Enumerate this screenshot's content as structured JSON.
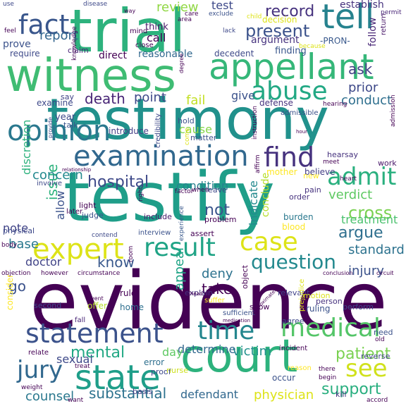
{
  "words": [
    {
      "text": "evidence",
      "color": "#440154"
    },
    {
      "text": "testify",
      "color": "#1f9e89"
    },
    {
      "text": "testimony",
      "color": "#21918c"
    },
    {
      "text": "trial",
      "color": "#2db27d"
    },
    {
      "text": "witness",
      "color": "#3fbc73"
    },
    {
      "text": "court",
      "color": "#2db27d"
    },
    {
      "text": "appellant",
      "color": "#35b779"
    },
    {
      "text": "examination",
      "color": "#31688e"
    },
    {
      "text": "statement",
      "color": "#3b528b"
    },
    {
      "text": "expert",
      "color": "#dde318"
    },
    {
      "text": "state",
      "color": "#1f9e89"
    },
    {
      "text": "result",
      "color": "#20a486"
    },
    {
      "text": "opinion",
      "color": "#2a788e"
    },
    {
      "text": "fact",
      "color": "#39568c"
    },
    {
      "text": "tell",
      "color": "#26828e"
    },
    {
      "text": "abuse",
      "color": "#22a884"
    },
    {
      "text": "time",
      "color": "#24868e"
    },
    {
      "text": "medical",
      "color": "#54c568"
    },
    {
      "text": "case",
      "color": "#dde318"
    },
    {
      "text": "find",
      "color": "#46327e"
    },
    {
      "text": "admit",
      "color": "#2ab07f"
    },
    {
      "text": "jury",
      "color": "#31688e"
    },
    {
      "text": "question",
      "color": "#23898e"
    },
    {
      "text": "see",
      "color": "#d0e11c"
    },
    {
      "text": "hospital",
      "color": "#3e4989"
    },
    {
      "text": "present",
      "color": "#3b528b"
    },
    {
      "text": "record",
      "color": "#46327e"
    },
    {
      "text": "argue",
      "color": "#2e6f8e"
    },
    {
      "text": "cross",
      "color": "#7ad151"
    },
    {
      "text": "not",
      "color": "#39558c"
    },
    {
      "text": "mental",
      "color": "#22a884"
    },
    {
      "text": "support",
      "color": "#29af7f"
    },
    {
      "text": "patient",
      "color": "#7ad151"
    },
    {
      "text": "death",
      "color": "#482576"
    },
    {
      "text": "report",
      "color": "#32658e"
    },
    {
      "text": "ask",
      "color": "#433e85"
    },
    {
      "text": "know",
      "color": "#38588c"
    },
    {
      "text": "take",
      "color": "#440154"
    },
    {
      "text": "issue",
      "color": "#2db27d"
    },
    {
      "text": "physician",
      "color": "#dde318"
    },
    {
      "text": "substantial",
      "color": "#2c728e"
    },
    {
      "text": "defendant",
      "color": "#31688e"
    },
    {
      "text": "counsel",
      "color": "#2a788e"
    },
    {
      "text": "sexual",
      "color": "#3e4989"
    },
    {
      "text": "victim",
      "color": "#21918c"
    },
    {
      "text": "determine",
      "color": "#31688e"
    },
    {
      "text": "injury",
      "color": "#3b528b"
    },
    {
      "text": "treatment",
      "color": "#4ac16d"
    },
    {
      "text": "verdict",
      "color": "#5ec962"
    },
    {
      "text": "condition",
      "color": "#26828e"
    },
    {
      "text": "concern",
      "color": "#23898e"
    },
    {
      "text": "standard",
      "color": "#2c728e"
    },
    {
      "text": "review",
      "color": "#90d743"
    },
    {
      "text": "prior",
      "color": "#3e4989"
    },
    {
      "text": "conduct",
      "color": "#2e6f8e"
    },
    {
      "text": "give",
      "color": "#3b528b"
    },
    {
      "text": "fail",
      "color": "#c2df23"
    },
    {
      "text": "point",
      "color": "#3e4989"
    },
    {
      "text": "cause",
      "color": "#86d549"
    },
    {
      "text": "discretion",
      "color": "#2db27d"
    },
    {
      "text": "base",
      "color": "#2a788e"
    },
    {
      "text": "go",
      "color": "#3b528b"
    },
    {
      "text": "doctor",
      "color": "#414487"
    },
    {
      "text": "deny",
      "color": "#2c728e"
    },
    {
      "text": "appeal",
      "color": "#20a486"
    },
    {
      "text": "day",
      "color": "#5ec962"
    },
    {
      "text": "note",
      "color": "#414487"
    },
    {
      "text": "allow",
      "color": "#3b528b"
    },
    {
      "text": "indicate",
      "color": "#23898e"
    },
    {
      "text": "conclude",
      "color": "#b5de2b"
    },
    {
      "text": "argument",
      "color": "#46327e"
    },
    {
      "text": "test",
      "color": "#3e4989"
    },
    {
      "text": "prove",
      "color": "#3b528b"
    },
    {
      "text": "require",
      "color": "#3e4989"
    },
    {
      "text": "reasonable",
      "color": "#31688e"
    },
    {
      "text": "direct",
      "color": "#440154"
    },
    {
      "text": "finding",
      "color": "#39568c"
    },
    {
      "text": "follow",
      "color": "#482677"
    },
    {
      "text": "establish",
      "color": "#46327e"
    },
    {
      "text": "call",
      "color": "#440154"
    },
    {
      "text": "think",
      "color": "#481769"
    },
    {
      "text": "-PRON-",
      "color": "#38588c"
    },
    {
      "text": "year",
      "color": "#3e4989"
    },
    {
      "text": "believe",
      "color": "#433e85"
    },
    {
      "text": "defense",
      "color": "#46327e"
    },
    {
      "text": "hold",
      "color": "#3b528b"
    },
    {
      "text": "introduce",
      "color": "#433e85"
    },
    {
      "text": "talk",
      "color": "#39558c"
    },
    {
      "text": "matter",
      "color": "#3b528b"
    },
    {
      "text": "examine",
      "color": "#3e4989"
    },
    {
      "text": "light",
      "color": "#440154"
    },
    {
      "text": "judge",
      "color": "#3b528b"
    },
    {
      "text": "include",
      "color": "#481769"
    },
    {
      "text": "problem",
      "color": "#440154"
    },
    {
      "text": "physical",
      "color": "#3e4989"
    },
    {
      "text": "rule",
      "color": "#440154"
    },
    {
      "text": "offer",
      "color": "#b5de2b"
    },
    {
      "text": "home",
      "color": "#2e6f8e"
    },
    {
      "text": "explain",
      "color": "#46327e"
    },
    {
      "text": "error",
      "color": "#2e6f8e"
    },
    {
      "text": "proof",
      "color": "#3e4989"
    },
    {
      "text": "ruling",
      "color": "#3b528b"
    },
    {
      "text": "person",
      "color": "#46327e"
    },
    {
      "text": "perform",
      "color": "#3e4989"
    },
    {
      "text": "relevant",
      "color": "#414487"
    },
    {
      "text": "motion",
      "color": "#dde318"
    },
    {
      "text": "basis",
      "color": "#433e85"
    },
    {
      "text": "consider",
      "color": "#fde725"
    },
    {
      "text": "blood",
      "color": "#fde725"
    },
    {
      "text": "burden",
      "color": "#2a788e"
    },
    {
      "text": "hearsay",
      "color": "#46327e"
    },
    {
      "text": "work",
      "color": "#481769"
    },
    {
      "text": "pain",
      "color": "#46327e"
    },
    {
      "text": "order",
      "color": "#46327e"
    },
    {
      "text": "claim",
      "color": "#482576"
    },
    {
      "text": "mind",
      "color": "#440154"
    },
    {
      "text": "say",
      "color": "#414487"
    },
    {
      "text": "fall",
      "color": "#482576"
    },
    {
      "text": "second",
      "color": "#3e4989"
    },
    {
      "text": "mother",
      "color": "#fde725"
    },
    {
      "text": "experience",
      "color": "#38588c"
    },
    {
      "text": "assert",
      "color": "#440154"
    },
    {
      "text": "interview",
      "color": "#3b528b"
    },
    {
      "text": "leave",
      "color": "#3e4989"
    },
    {
      "text": "agree",
      "color": "#3e4989"
    },
    {
      "text": "show",
      "color": "#440154"
    },
    {
      "text": "new",
      "color": "#fde725"
    },
    {
      "text": "object",
      "color": "#440154"
    },
    {
      "text": "sufficient",
      "color": "#3b528b"
    },
    {
      "text": "incident",
      "color": "#440154"
    },
    {
      "text": "reverse",
      "color": "#414487"
    },
    {
      "text": "occur",
      "color": "#3b528b"
    },
    {
      "text": "decision",
      "color": "#dde318"
    },
    {
      "text": "nurse",
      "color": "#cde11d"
    },
    {
      "text": "kill",
      "color": "#46327e"
    },
    {
      "text": "relate",
      "color": "#440154"
    },
    {
      "text": "need",
      "color": "#3b528b"
    },
    {
      "text": "use",
      "color": "#3e4989"
    },
    {
      "text": "feel",
      "color": "#440154"
    },
    {
      "text": "disease",
      "color": "#3e4989"
    },
    {
      "text": "care",
      "color": "#440154"
    },
    {
      "text": "exclude",
      "color": "#3b528b"
    },
    {
      "text": "area",
      "color": "#440154"
    },
    {
      "text": "child",
      "color": "#dde318"
    },
    {
      "text": "permit",
      "color": "#482576"
    },
    {
      "text": "lack",
      "color": "#3e4989"
    },
    {
      "text": "return",
      "color": "#481769"
    },
    {
      "text": "close",
      "color": "#440154"
    },
    {
      "text": "because",
      "color": "#dde318"
    },
    {
      "text": "knowledge",
      "color": "#440154"
    },
    {
      "text": "decedent",
      "color": "#3e4989"
    },
    {
      "text": "admissible",
      "color": "#3b528b"
    },
    {
      "text": "hearing",
      "color": "#440154"
    },
    {
      "text": "degree",
      "color": "#440154"
    },
    {
      "text": "credibility",
      "color": "#3e4989"
    },
    {
      "text": "instruction",
      "color": "#440154"
    },
    {
      "text": "involve",
      "color": "#3e4989"
    },
    {
      "text": "provide",
      "color": "#3e4989"
    },
    {
      "text": "come",
      "color": "#dde318"
    },
    {
      "text": "affirm",
      "color": "#440154"
    },
    {
      "text": "meet",
      "color": "#440154"
    },
    {
      "text": "heart",
      "color": "#440154"
    },
    {
      "text": "factor",
      "color": "#440154"
    },
    {
      "text": "when",
      "color": "#440154"
    },
    {
      "text": "suffer",
      "color": "#fde725"
    },
    {
      "text": "right",
      "color": "#440154"
    },
    {
      "text": "later",
      "color": "#440154"
    },
    {
      "text": "contend",
      "color": "#3e4989"
    },
    {
      "text": "room",
      "color": "#440154"
    },
    {
      "text": "objection",
      "color": "#440154"
    },
    {
      "text": "however",
      "color": "#440154"
    },
    {
      "text": "circumstance",
      "color": "#440154"
    },
    {
      "text": "conclusion",
      "color": "#440154"
    },
    {
      "text": "circuit",
      "color": "#440154"
    },
    {
      "text": "prejudice",
      "color": "#dde318"
    },
    {
      "text": "reason",
      "color": "#fde725"
    },
    {
      "text": "there",
      "color": "#440154"
    },
    {
      "text": "begin",
      "color": "#440154"
    },
    {
      "text": "treat",
      "color": "#440154"
    },
    {
      "text": "weight",
      "color": "#440154"
    },
    {
      "text": "want",
      "color": "#440154"
    },
    {
      "text": "accord",
      "color": "#440154"
    },
    {
      "text": "body",
      "color": "#440154"
    },
    {
      "text": "event",
      "color": "#440154"
    },
    {
      "text": "old",
      "color": "#440154"
    },
    {
      "text": "way",
      "color": "#440154"
    },
    {
      "text": "admission",
      "color": "#440154"
    },
    {
      "text": "relationship",
      "color": "#440154"
    },
    {
      "text": "approximately",
      "color": "#440154"
    },
    {
      "text": "medication",
      "color": "#440154"
    },
    {
      "text": "head",
      "color": "#440154"
    },
    {
      "text": "hour",
      "color": "#440154"
    },
    {
      "text": "question",
      "color": "#440154"
    },
    {
      "text": "give",
      "color": "#440154"
    }
  ]
}
